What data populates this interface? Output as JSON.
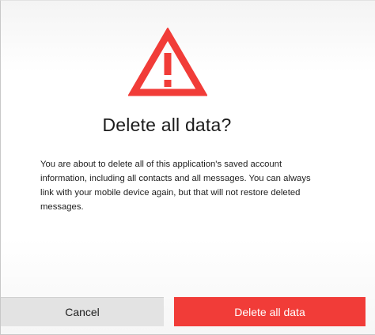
{
  "dialog": {
    "icon": "warning-triangle-icon",
    "title": "Delete all data?",
    "message": "You are about to delete all of this application's saved account information, including all contacts and all messages. You can always link with your mobile device again, but that will not restore deleted messages.",
    "cancel_label": "Cancel",
    "confirm_label": "Delete all data"
  },
  "colors": {
    "accent": "#f13c38",
    "secondary_button": "#e3e3e3"
  }
}
